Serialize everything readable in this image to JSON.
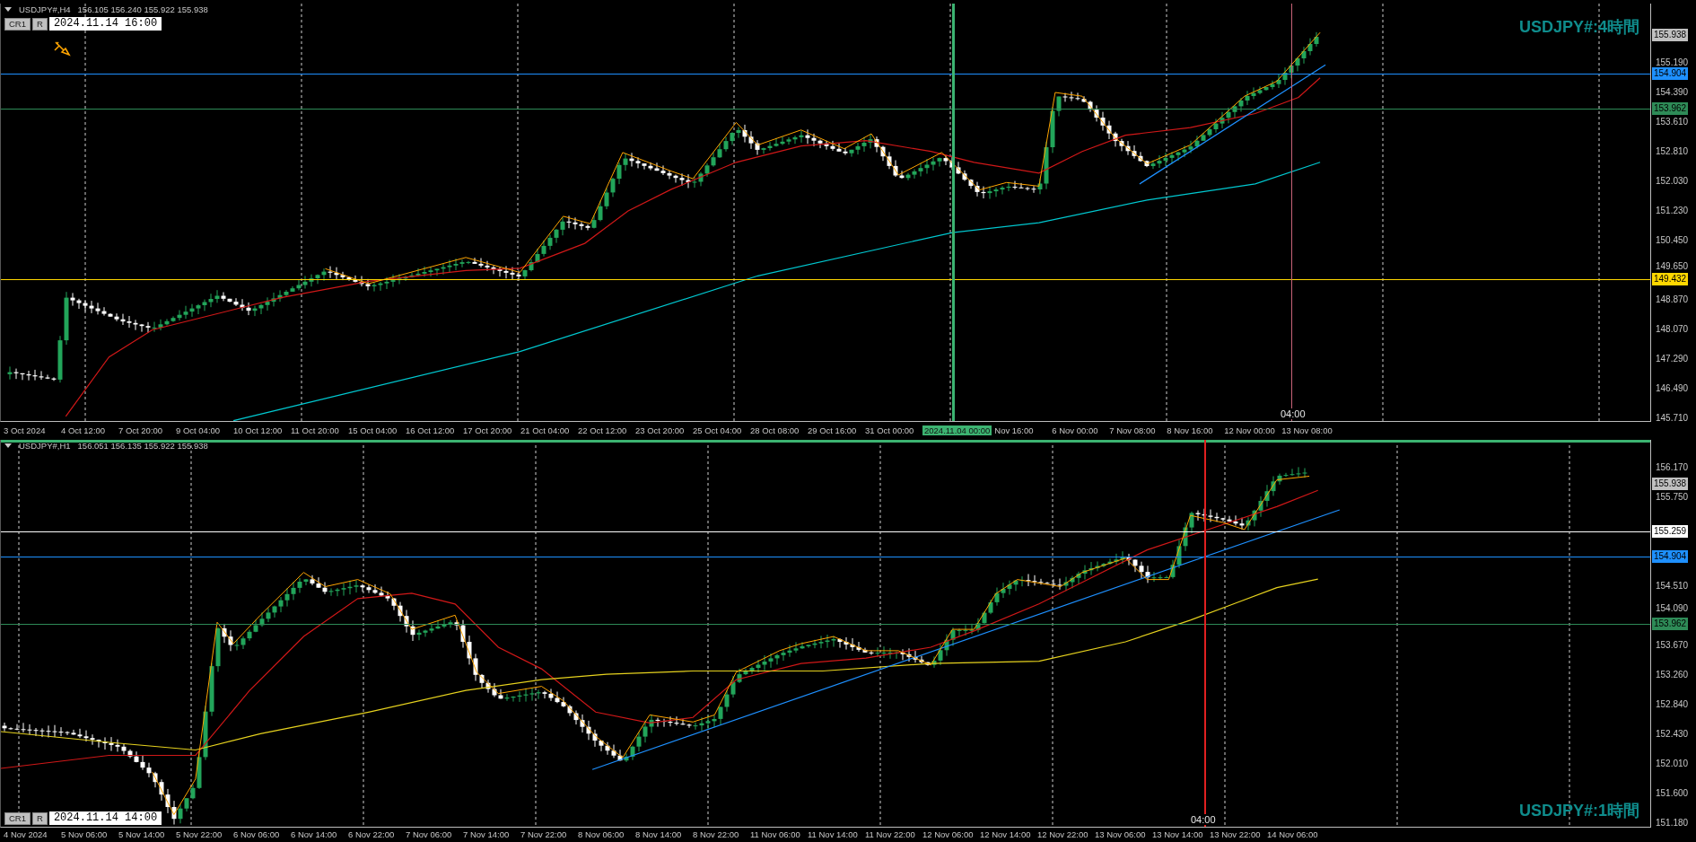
{
  "charts": [
    {
      "symbol": "USDJPY#,H4",
      "ohlc": "156.105 156.240 155.922 155.938",
      "buttons": [
        "CR1",
        "R"
      ],
      "cursor_time": "2024.11.14 16:00",
      "title": "USDJPY#:4時間",
      "crosshair_label": "04:00",
      "price_ticks": [
        "155.190",
        "154.390",
        "153.610",
        "152.810",
        "152.030",
        "151.230",
        "150.450",
        "149.650",
        "148.870",
        "148.070",
        "147.290",
        "146.490",
        "145.710"
      ],
      "price_lines": [
        {
          "kind": "bid",
          "label": "155.938",
          "color": "#c0c0c0"
        },
        {
          "kind": "line",
          "label": "154.904",
          "color": "#1e90ff"
        },
        {
          "kind": "line",
          "label": "153.962",
          "color": "#2e8b57"
        },
        {
          "kind": "line",
          "label": "149.432",
          "color": "#ffd700"
        }
      ],
      "time_labels": [
        {
          "label": "3 Oct 2024",
          "selected": false
        },
        {
          "label": "4 Oct 12:00",
          "selected": false
        },
        {
          "label": "7 Oct 20:00",
          "selected": false
        },
        {
          "label": "9 Oct 04:00",
          "selected": false
        },
        {
          "label": "10 Oct 12:00",
          "selected": false
        },
        {
          "label": "11 Oct 20:00",
          "selected": false
        },
        {
          "label": "15 Oct 04:00",
          "selected": false
        },
        {
          "label": "16 Oct 12:00",
          "selected": false
        },
        {
          "label": "17 Oct 20:00",
          "selected": false
        },
        {
          "label": "21 Oct 04:00",
          "selected": false
        },
        {
          "label": "22 Oct 12:00",
          "selected": false
        },
        {
          "label": "23 Oct 20:00",
          "selected": false
        },
        {
          "label": "25 Oct 04:00",
          "selected": false
        },
        {
          "label": "28 Oct 08:00",
          "selected": false
        },
        {
          "label": "29 Oct 16:00",
          "selected": false
        },
        {
          "label": "31 Oct 00:00",
          "selected": false
        },
        {
          "label": "2024.11.04 00:00",
          "selected": true
        },
        {
          "label": "Nov 16:00",
          "selected": false
        },
        {
          "label": "6 Nov 00:00",
          "selected": false
        },
        {
          "label": "7 Nov 08:00",
          "selected": false
        },
        {
          "label": "8 Nov 16:00",
          "selected": false
        },
        {
          "label": "12 Nov 00:00",
          "selected": false
        },
        {
          "label": "13 Nov 08:00",
          "selected": false
        }
      ]
    },
    {
      "symbol": "USDJPY#,H1",
      "ohlc": "156.051 156.135 155.922 155.938",
      "buttons": [
        "CR1",
        "R"
      ],
      "cursor_time": "2024.11.14 14:00",
      "title": "USDJPY#:1時間",
      "crosshair_label": "04:00",
      "price_ticks": [
        "156.170",
        "155.750",
        "154.510",
        "154.090",
        "153.670",
        "153.260",
        "152.840",
        "152.430",
        "152.010",
        "151.600",
        "151.180"
      ],
      "price_lines": [
        {
          "kind": "bid",
          "label": "155.938",
          "color": "#c0c0c0"
        },
        {
          "kind": "line",
          "label": "155.259",
          "color": "#ffffff"
        },
        {
          "kind": "line",
          "label": "154.904",
          "color": "#1e90ff"
        },
        {
          "kind": "line",
          "label": "153.962",
          "color": "#2e8b57"
        }
      ],
      "time_labels": [
        {
          "label": "4 Nov 2024",
          "selected": false
        },
        {
          "label": "5 Nov 06:00",
          "selected": false
        },
        {
          "label": "5 Nov 14:00",
          "selected": false
        },
        {
          "label": "5 Nov 22:00",
          "selected": false
        },
        {
          "label": "6 Nov 06:00",
          "selected": false
        },
        {
          "label": "6 Nov 14:00",
          "selected": false
        },
        {
          "label": "6 Nov 22:00",
          "selected": false
        },
        {
          "label": "7 Nov 06:00",
          "selected": false
        },
        {
          "label": "7 Nov 14:00",
          "selected": false
        },
        {
          "label": "7 Nov 22:00",
          "selected": false
        },
        {
          "label": "8 Nov 06:00",
          "selected": false
        },
        {
          "label": "8 Nov 14:00",
          "selected": false
        },
        {
          "label": "8 Nov 22:00",
          "selected": false
        },
        {
          "label": "11 Nov 06:00",
          "selected": false
        },
        {
          "label": "11 Nov 14:00",
          "selected": false
        },
        {
          "label": "11 Nov 22:00",
          "selected": false
        },
        {
          "label": "12 Nov 06:00",
          "selected": false
        },
        {
          "label": "12 Nov 14:00",
          "selected": false
        },
        {
          "label": "12 Nov 22:00",
          "selected": false
        },
        {
          "label": "13 Nov 06:00",
          "selected": false
        },
        {
          "label": "13 Nov 14:00",
          "selected": false
        },
        {
          "label": "13 Nov 22:00",
          "selected": false
        },
        {
          "label": "14 Nov 06:00",
          "selected": false
        }
      ]
    }
  ]
}
